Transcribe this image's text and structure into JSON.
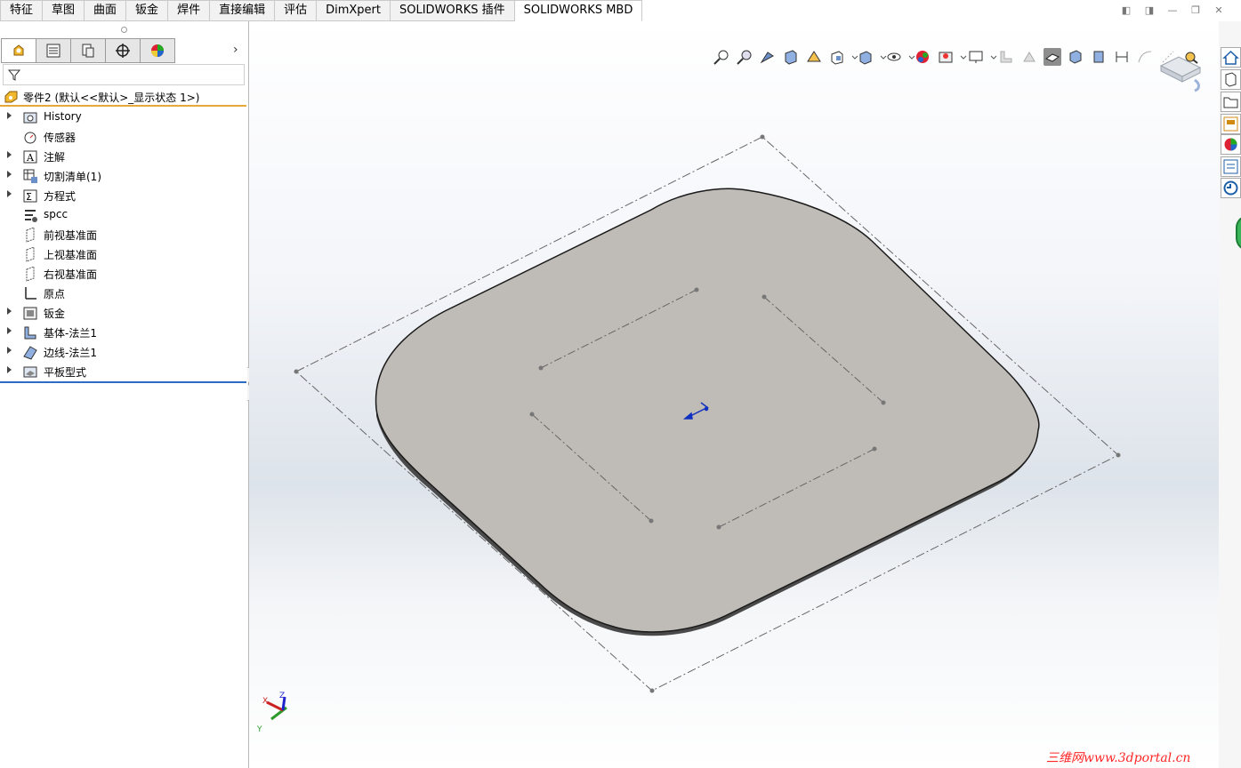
{
  "tabs": {
    "items": [
      "特征",
      "草图",
      "曲面",
      "钣金",
      "焊件",
      "直接编辑",
      "评估",
      "DimXpert",
      "SOLIDWORKS 插件",
      "SOLIDWORKS MBD"
    ],
    "active_index": 9
  },
  "feature_manager": {
    "panel_tabs": [
      "featuremanager-icon",
      "propertymanager-icon",
      "configurationmanager-icon",
      "dimxpertmanager-icon",
      "displaymanager-icon"
    ],
    "part_name": "零件2  (默认<<默认>_显示状态 1>)",
    "tree": [
      {
        "label": "History",
        "icon": "history-folder-icon",
        "expandable": true
      },
      {
        "label": "传感器",
        "icon": "sensor-icon",
        "expandable": false
      },
      {
        "label": "注解",
        "icon": "annotation-icon",
        "expandable": true
      },
      {
        "label": "切割清单(1)",
        "icon": "cut-list-icon",
        "expandable": true
      },
      {
        "label": "方程式",
        "icon": "equation-icon",
        "expandable": true
      },
      {
        "label": "spcc",
        "icon": "material-icon",
        "expandable": false
      },
      {
        "label": "前视基准面",
        "icon": "plane-icon",
        "expandable": false
      },
      {
        "label": "上视基准面",
        "icon": "plane-icon",
        "expandable": false
      },
      {
        "label": "右视基准面",
        "icon": "plane-icon",
        "expandable": false
      },
      {
        "label": "原点",
        "icon": "origin-icon",
        "expandable": false
      },
      {
        "label": "钣金",
        "icon": "sheet-metal-icon",
        "expandable": true
      },
      {
        "label": "基体-法兰1",
        "icon": "base-flange-icon",
        "expandable": true
      },
      {
        "label": "边线-法兰1",
        "icon": "edge-flange-icon",
        "expandable": true
      },
      {
        "label": "平板型式",
        "icon": "flat-pattern-icon",
        "expandable": true
      }
    ]
  },
  "triad": {
    "x": "X",
    "y": "Y",
    "z": "Z"
  },
  "watermark": "三维网www.3dportal.cn",
  "colors": {
    "accent_orange": "#e7a83a",
    "accent_blue": "#2b6cc4",
    "part_face": "#bfbbb6",
    "part_edge": "#1a1a1a"
  }
}
